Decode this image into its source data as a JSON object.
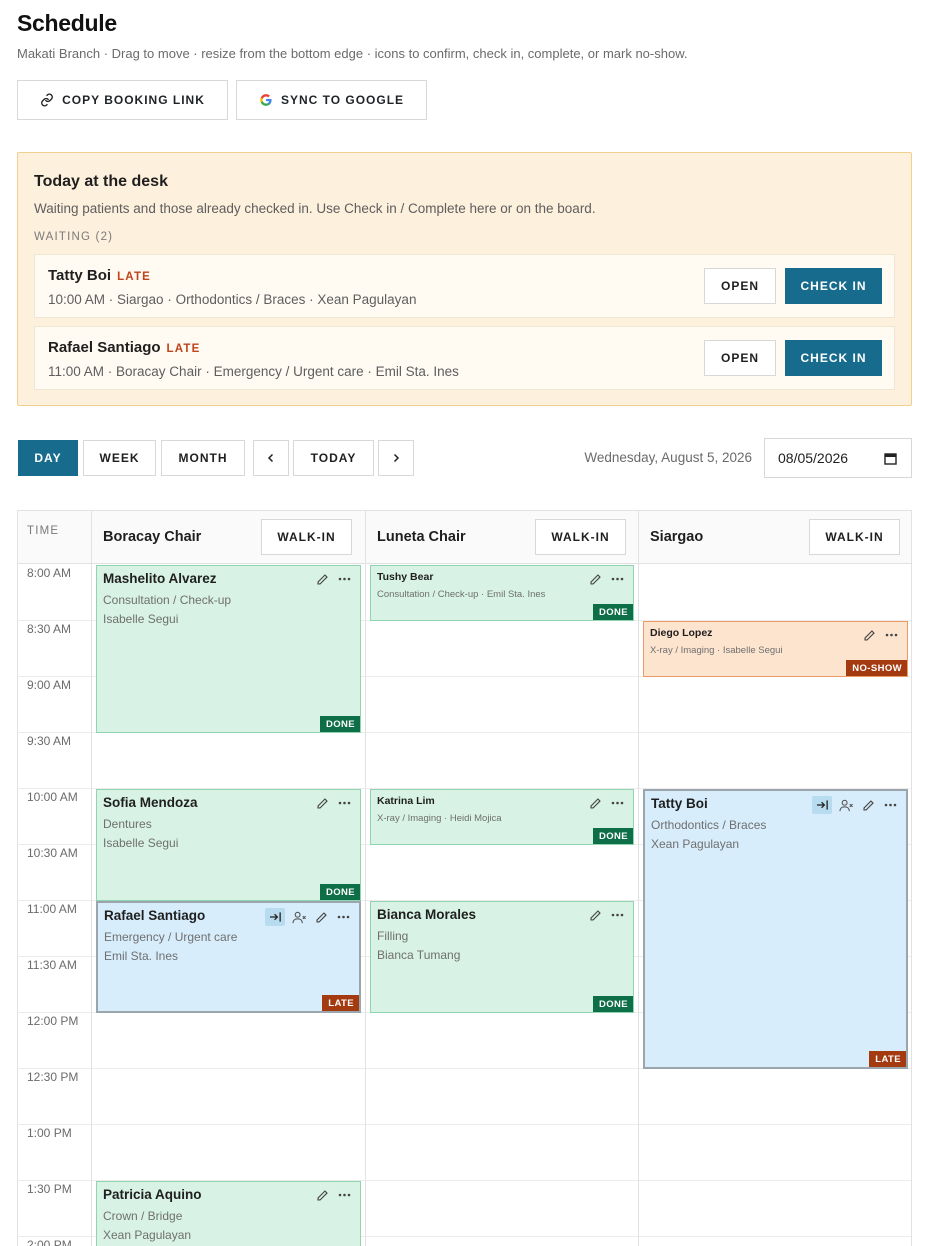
{
  "page": {
    "title": "Schedule",
    "subtitle": "Makati Branch · Drag to move · resize from the bottom edge · icons to confirm, check in, complete, or mark no-show."
  },
  "actions": {
    "copy_link": "COPY BOOKING LINK",
    "sync_google": "SYNC TO GOOGLE"
  },
  "desk": {
    "title": "Today at the desk",
    "description": "Waiting patients and those already checked in. Use Check in / Complete here or on the board.",
    "waiting_label": "WAITING (2)",
    "open_label": "OPEN",
    "checkin_label": "CHECK IN",
    "late_label": "LATE",
    "rows": [
      {
        "name": "Tatty Boi",
        "detail": "10:00 AM · Siargao · Orthodontics / Braces · Xean Pagulayan"
      },
      {
        "name": "Rafael Santiago",
        "detail": "11:00 AM · Boracay Chair · Emergency / Urgent care · Emil Sta. Ines"
      }
    ]
  },
  "toolbar": {
    "day": "DAY",
    "week": "WEEK",
    "month": "MONTH",
    "prev": "‹",
    "today": "TODAY",
    "next": "›",
    "date_label": "Wednesday, August 5, 2026",
    "date_value": "08/05/2026",
    "active_view": "DAY"
  },
  "board": {
    "time_header": "TIME",
    "walkin_label": "WALK-IN",
    "columns": [
      "Boracay Chair",
      "Luneta Chair",
      "Siargao"
    ],
    "times": [
      "8:00 AM",
      "8:30 AM",
      "9:00 AM",
      "9:30 AM",
      "10:00 AM",
      "10:30 AM",
      "11:00 AM",
      "11:30 AM",
      "12:00 PM",
      "12:30 PM",
      "1:00 PM",
      "1:30 PM",
      "2:00 PM"
    ],
    "appointments": [
      {
        "name": "Mashelito Alvarez",
        "service": "Consultation / Check-up",
        "staff": "Isabelle Segui",
        "status": "DONE"
      },
      {
        "name": "Tushy Bear",
        "service": "Consultation / Check-up · Emil Sta. Ines",
        "status": "DONE"
      },
      {
        "name": "Diego Lopez",
        "service": "X-ray / Imaging · Isabelle Segui",
        "status": "NO-SHOW"
      },
      {
        "name": "Sofia Mendoza",
        "service": "Dentures",
        "staff": "Isabelle Segui",
        "status": "DONE"
      },
      {
        "name": "Katrina Lim",
        "service": "X-ray / Imaging · Heidi Mojica",
        "status": "DONE"
      },
      {
        "name": "Tatty Boi",
        "service": "Orthodontics / Braces",
        "staff": "Xean Pagulayan",
        "status": "LATE"
      },
      {
        "name": "Rafael Santiago",
        "service": "Emergency / Urgent care",
        "staff": "Emil Sta. Ines",
        "status": "LATE"
      },
      {
        "name": "Bianca Morales",
        "service": "Filling",
        "staff": "Bianca Tumang",
        "status": "DONE"
      },
      {
        "name": "Patricia Aquino",
        "service": "Crown / Bridge",
        "staff": "Xean Pagulayan",
        "status": ""
      }
    ]
  },
  "icons": {
    "copy_link": "link-icon",
    "sync": "google-g-icon",
    "edit": "pencil-icon",
    "more": "ellipsis-icon",
    "check_in": "check-in-arrow-icon",
    "no_show": "user-x-icon",
    "calendar": "calendar-icon"
  },
  "colors": {
    "accent": "#176b8c",
    "done_bg": "#d8f3e5",
    "checked_in_bg": "#d7edfb",
    "no_show_bg": "#fde4cf",
    "late": "#c0431a",
    "desk_bg": "#fdf0dc"
  }
}
